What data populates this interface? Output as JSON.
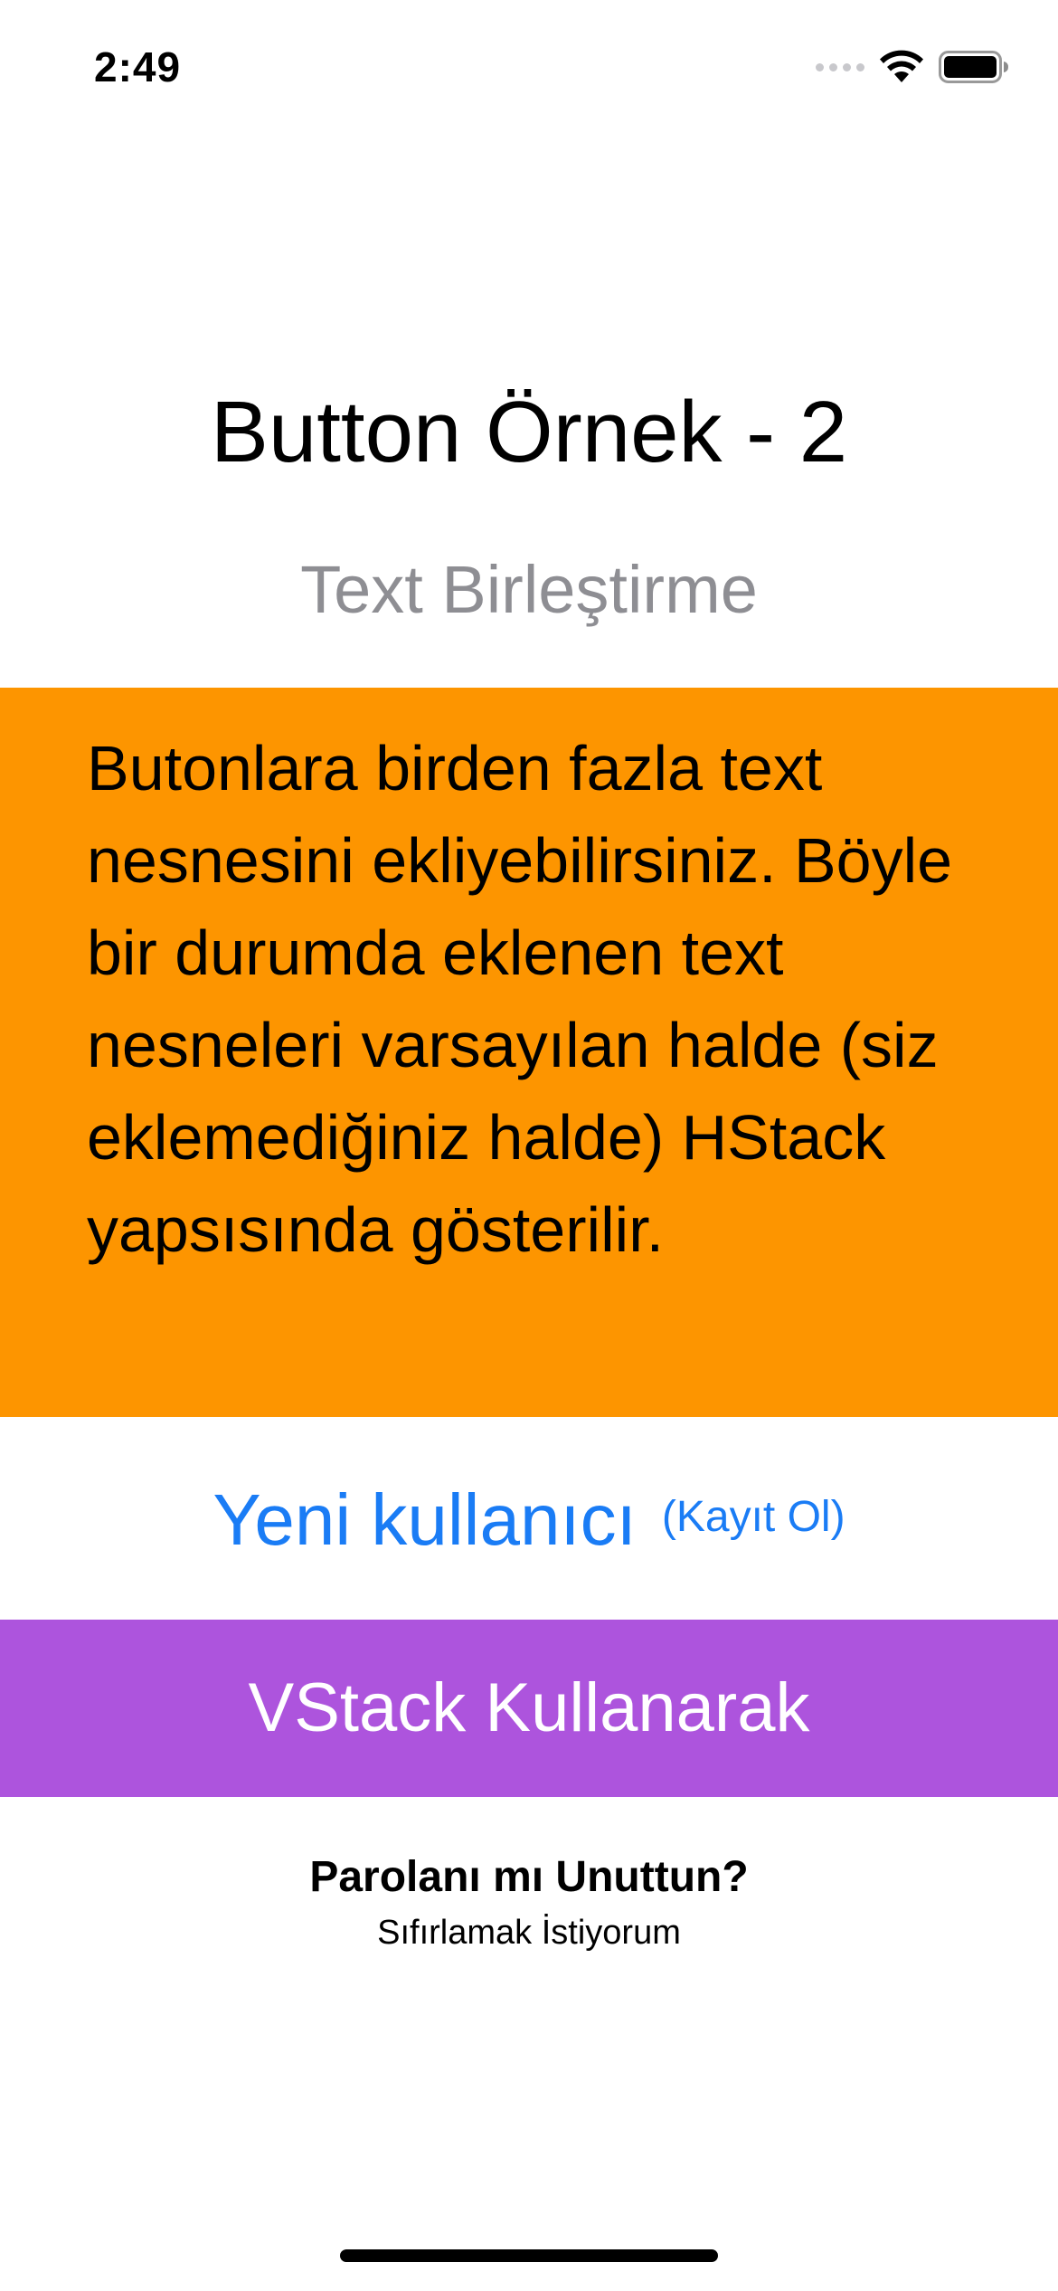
{
  "status_bar": {
    "time": "2:49",
    "icons": [
      "signal-icon",
      "wifi-icon",
      "battery-icon"
    ]
  },
  "header": {
    "title": "Button Örnek - 2",
    "subtitle": "Text Birleştirme"
  },
  "info": {
    "text": "Butonlara birden fazla text nesnesini ekliyebilirsiniz. Böyle bir durumda eklenen text nesneleri varsayılan halde (siz eklemediğiniz halde) HStack yapsısında gösterilir.",
    "background": "#FD9500"
  },
  "buttons": {
    "new_user": {
      "main_label": "Yeni kullanıcı",
      "sub_label": "(Kayıt Ol)",
      "color": "#1A7CF5"
    },
    "vstack": {
      "label": "VStack Kullanarak",
      "background": "#AD54DD"
    },
    "reset": {
      "title": "Parolanı mı Unuttun?",
      "subtitle": "Sıfırlamak İstiyorum"
    }
  }
}
